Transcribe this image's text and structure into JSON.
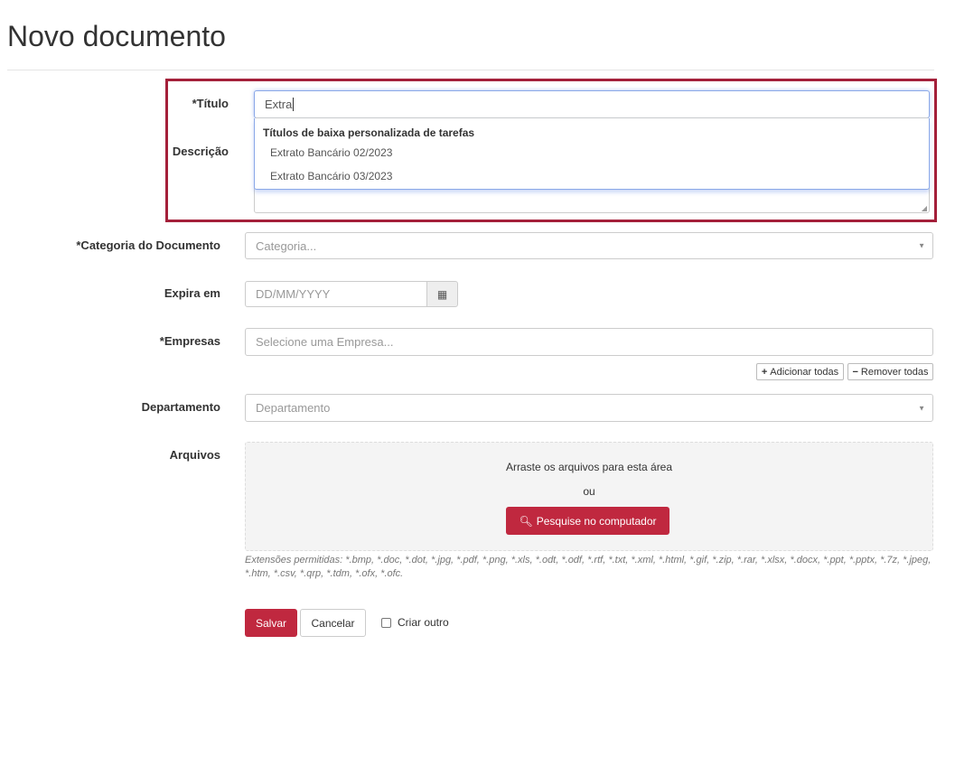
{
  "page": {
    "title": "Novo documento"
  },
  "form": {
    "titulo": {
      "label": "*Título",
      "value": "Extra"
    },
    "autocomplete": {
      "group": "Títulos de baixa personalizada de tarefas",
      "items": [
        "Extrato Bancário 02/2023",
        "Extrato Bancário 03/2023"
      ]
    },
    "descricao": {
      "label": "Descrição"
    },
    "categoria": {
      "label": "*Categoria do Documento",
      "placeholder": "Categoria..."
    },
    "expira": {
      "label": "Expira em",
      "placeholder": "DD/MM/YYYY"
    },
    "empresas": {
      "label": "*Empresas",
      "placeholder": "Selecione uma Empresa...",
      "add_all": "Adicionar todas",
      "remove_all": "Remover todas"
    },
    "departamento": {
      "label": "Departamento",
      "placeholder": "Departamento"
    },
    "arquivos": {
      "label": "Arquivos",
      "drop_text": "Arraste os arquivos para esta área",
      "or": "ou",
      "browse": "Pesquise no computador",
      "extensions": "Extensões permitidas: *.bmp, *.doc, *.dot, *.jpg, *.pdf, *.png, *.xls, *.odt, *.odf, *.rtf, *.txt, *.xml, *.html, *.gif, *.zip, *.rar, *.xlsx, *.docx, *.ppt, *.pptx, *.7z, *.jpeg, *.htm, *.csv, *.qrp, *.tdm, *.ofx, *.ofc."
    },
    "actions": {
      "save": "Salvar",
      "cancel": "Cancelar",
      "create_another": "Criar outro"
    }
  },
  "colors": {
    "accent": "#c0283f",
    "highlight_border": "#a4203a"
  }
}
